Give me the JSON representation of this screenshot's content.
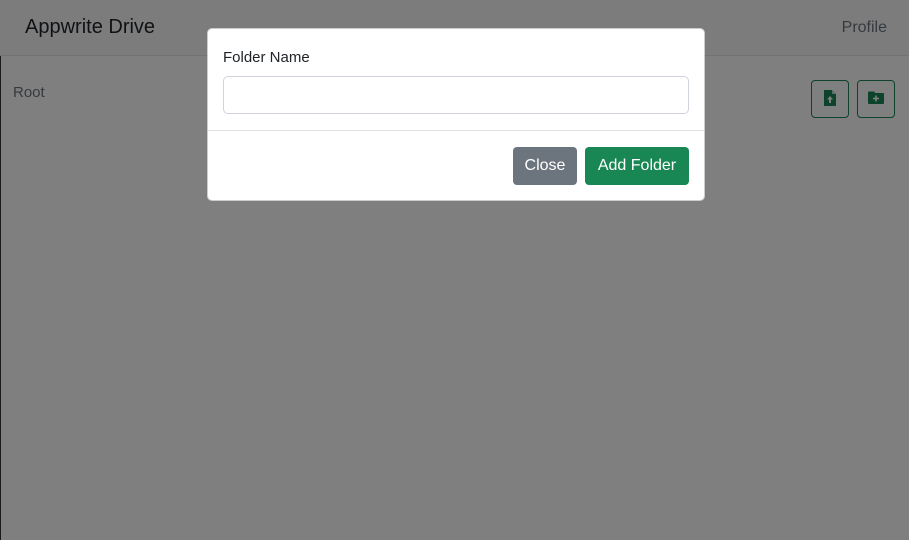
{
  "navbar": {
    "brand": "Appwrite Drive",
    "profile_label": "Profile"
  },
  "breadcrumb": {
    "current": "Root"
  },
  "toolbar": {
    "upload_icon": "file-upload-icon",
    "new_folder_icon": "folder-plus-icon",
    "accent_color": "#198754"
  },
  "modal": {
    "label": "Folder Name",
    "input_value": "",
    "input_placeholder": "",
    "close_label": "Close",
    "add_label": "Add Folder"
  }
}
